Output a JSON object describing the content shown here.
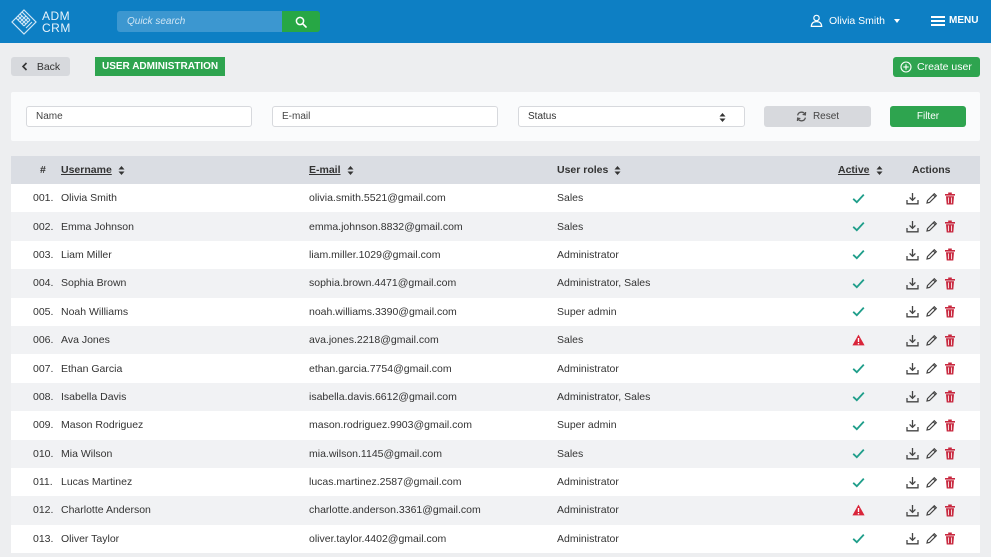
{
  "app": {
    "logo_line1": "ADM",
    "logo_line2": "CRM"
  },
  "header": {
    "search_placeholder": "Quick search",
    "user_name": "Olivia Smith",
    "menu_label": "MENU"
  },
  "subheader": {
    "back_label": "Back",
    "section_title": "USER ADMINISTRATION",
    "create_label": "Create user"
  },
  "filters": {
    "name_placeholder": "Name",
    "email_placeholder": "E-mail",
    "status_value": "Status",
    "reset_label": "Reset",
    "filter_label": "Filter"
  },
  "table": {
    "headers": {
      "num": "#",
      "username": "Username",
      "email": "E-mail",
      "roles": "User roles",
      "active": "Active",
      "actions": "Actions"
    },
    "rows": [
      {
        "num": "001.",
        "username": "Olivia Smith",
        "email": "olivia.smith.5521@gmail.com",
        "roles": "Sales",
        "active": "check"
      },
      {
        "num": "002.",
        "username": "Emma Johnson",
        "email": "emma.johnson.8832@gmail.com",
        "roles": "Sales",
        "active": "check"
      },
      {
        "num": "003.",
        "username": "Liam Miller",
        "email": "liam.miller.1029@gmail.com",
        "roles": "Administrator",
        "active": "check"
      },
      {
        "num": "004.",
        "username": "Sophia Brown",
        "email": "sophia.brown.4471@gmail.com",
        "roles": "Administrator, Sales",
        "active": "check"
      },
      {
        "num": "005.",
        "username": "Noah Williams",
        "email": "noah.williams.3390@gmail.com",
        "roles": "Super admin",
        "active": "check"
      },
      {
        "num": "006.",
        "username": "Ava Jones",
        "email": "ava.jones.2218@gmail.com",
        "roles": "Sales",
        "active": "warning"
      },
      {
        "num": "007.",
        "username": "Ethan Garcia",
        "email": "ethan.garcia.7754@gmail.com",
        "roles": "Administrator",
        "active": "check"
      },
      {
        "num": "008.",
        "username": "Isabella Davis",
        "email": "isabella.davis.6612@gmail.com",
        "roles": "Administrator, Sales",
        "active": "check"
      },
      {
        "num": "009.",
        "username": "Mason Rodriguez",
        "email": "mason.rodriguez.9903@gmail.com",
        "roles": "Super admin",
        "active": "check"
      },
      {
        "num": "010.",
        "username": "Mia Wilson",
        "email": "mia.wilson.1145@gmail.com",
        "roles": "Sales",
        "active": "check"
      },
      {
        "num": "011.",
        "username": "Lucas Martinez",
        "email": "lucas.martinez.2587@gmail.com",
        "roles": "Administrator",
        "active": "check"
      },
      {
        "num": "012.",
        "username": "Charlotte Anderson",
        "email": "charlotte.anderson.3361@gmail.com",
        "roles": "Administrator",
        "active": "warning"
      },
      {
        "num": "013.",
        "username": "Oliver Taylor",
        "email": "oliver.taylor.4402@gmail.com",
        "roles": "Administrator",
        "active": "check"
      }
    ]
  },
  "colors": {
    "header_bg": "#0d7fc4",
    "accent_green": "#2ea44f",
    "check_teal": "#1f9e8a",
    "warning_red": "#d9253a",
    "delete_red": "#c8283f"
  },
  "icons": {
    "logo": "logo-icon",
    "search": "search-icon",
    "user": "user-icon",
    "menu": "hamburger-icon",
    "back": "chevron-left-icon",
    "create": "plus-circle-icon",
    "reset": "refresh-icon",
    "sort": "sort-icon",
    "active_ok": "check-icon",
    "active_warn": "warning-icon",
    "download": "download-icon",
    "edit": "pencil-icon",
    "delete": "trash-icon"
  }
}
